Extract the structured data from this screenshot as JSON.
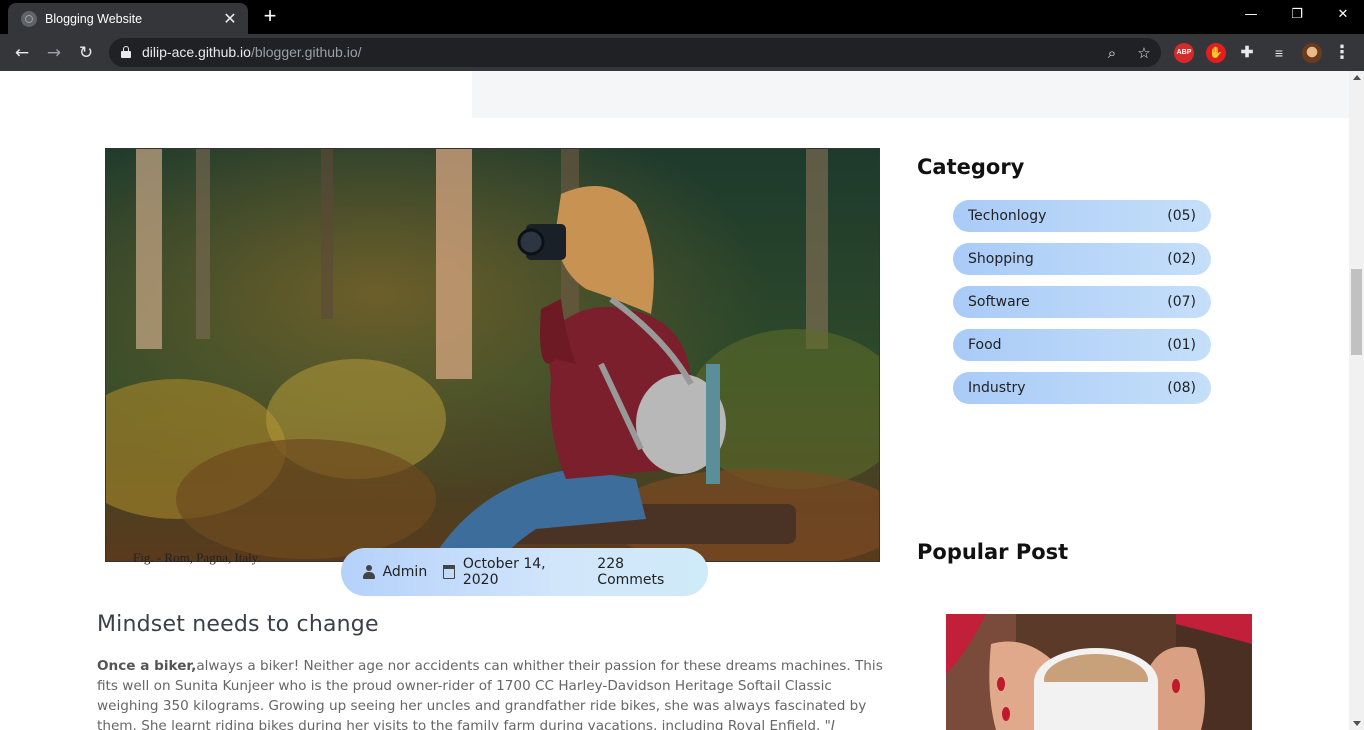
{
  "browser": {
    "tab_title": "Blogging Website",
    "url_host": "dilip-ace.github.io",
    "url_path": "/blogger.github.io/",
    "extensions": {
      "abp_label": "ABP"
    }
  },
  "post": {
    "image_alt": "Woman with camera sitting in autumn forest",
    "image_caption": "Fig. - Rom, Pagna, Italy.",
    "meta": {
      "author": "Admin",
      "date": "October 14, 2020",
      "comments": "228 Commets"
    },
    "title": "Mindset needs to change",
    "body_lead": "Once a biker,",
    "body_text": "always a biker! Neither age nor accidents can whither their passion for these dreams machines. This fits well on Sunita Kunjeer who is the proud owner-rider of 1700 CC Harley-Davidson Heritage Softail Classic weighing 350 kilograms. Growing up seeing her uncles and grandfather ride bikes, she was always fascinated by them. She learnt riding bikes during her visits to the family farm during vacations, including Royal Enfield.",
    "body_quote": "\"I started using"
  },
  "sidebar": {
    "category_heading": "Category",
    "categories": [
      {
        "name": "Techonlogy",
        "count": "(05)"
      },
      {
        "name": "Shopping",
        "count": "(02)"
      },
      {
        "name": "Software",
        "count": "(07)"
      },
      {
        "name": "Food",
        "count": "(01)"
      },
      {
        "name": "Industry",
        "count": "(08)"
      }
    ],
    "popular_heading": "Popular Post"
  },
  "colors": {
    "category_pill": "#a9cbf7",
    "meta_pill": "#b5d1fb",
    "chrome_dark": "#35363a"
  }
}
